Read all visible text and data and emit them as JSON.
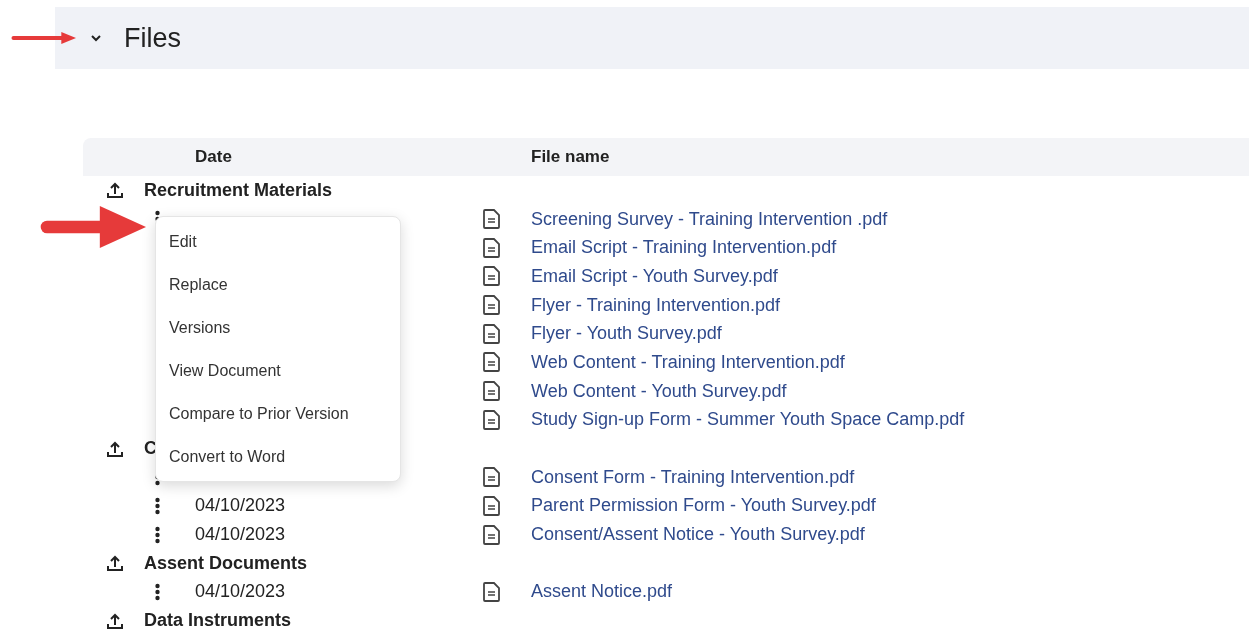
{
  "section": {
    "title": "Files",
    "expanded": true
  },
  "table": {
    "columns": [
      "Date",
      "File name"
    ],
    "groups": [
      {
        "name": "Recruitment Materials",
        "files": [
          {
            "menu_button": true,
            "name": "Screening Survey - Training Intervention .pdf"
          },
          {
            "name": "Email Script - Training Intervention.pdf"
          },
          {
            "name": "Email Script - Youth Survey.pdf"
          },
          {
            "name": "Flyer - Training Intervention.pdf"
          },
          {
            "name": "Flyer - Youth Survey.pdf"
          },
          {
            "name": "Web Content - Training Intervention.pdf"
          },
          {
            "name": "Web Content - Youth Survey.pdf"
          },
          {
            "name": "Study Sign-up Form - Summer Youth Space Camp.pdf"
          }
        ]
      },
      {
        "name": "C",
        "files": [
          {
            "menu_button": true,
            "name": "Consent Form - Training Intervention.pdf"
          },
          {
            "menu_button": true,
            "date": "04/10/2023",
            "name": "Parent Permission Form - Youth Survey.pdf"
          },
          {
            "menu_button": true,
            "date": "04/10/2023",
            "name": "Consent/Assent Notice - Youth Survey.pdf"
          }
        ]
      },
      {
        "name": "Assent Documents",
        "files": [
          {
            "menu_button": true,
            "date": "04/10/2023",
            "name": "Assent Notice.pdf"
          }
        ]
      },
      {
        "name": "Data Instruments"
      }
    ]
  },
  "context_menu": {
    "items": [
      "Edit",
      "Replace",
      "Versions",
      "View Document",
      "Compare to Prior Version",
      "Convert to Word"
    ]
  }
}
